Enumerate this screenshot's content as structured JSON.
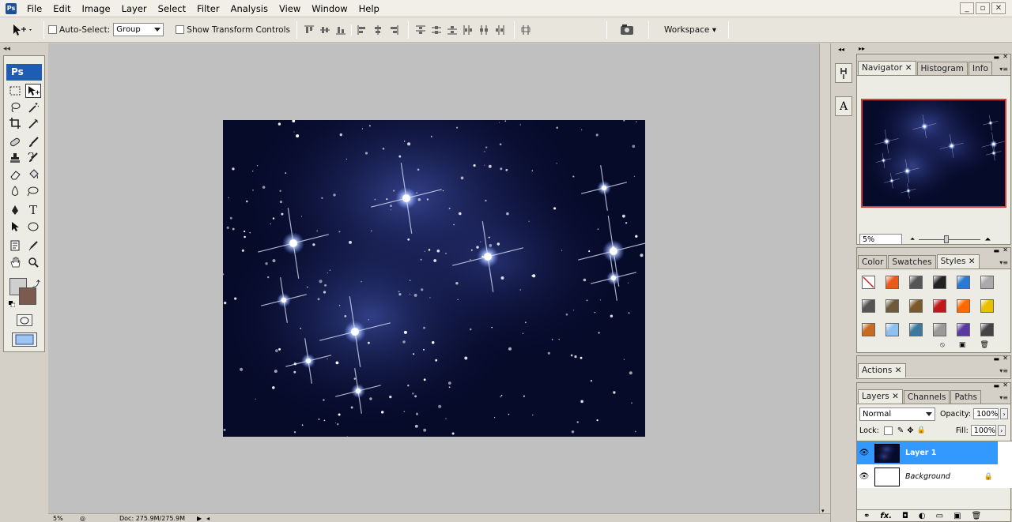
{
  "app": {
    "logo": "Ps"
  },
  "menu": [
    "File",
    "Edit",
    "Image",
    "Layer",
    "Select",
    "Filter",
    "Analysis",
    "View",
    "Window",
    "Help"
  ],
  "window_buttons": [
    "_",
    "▫",
    "✕"
  ],
  "options": {
    "auto_select_label": "Auto-Select:",
    "auto_select_value": "Group",
    "show_transform_label": "Show Transform Controls",
    "workspace_label": "Workspace ▾"
  },
  "toolbox": {
    "logo": "Ps"
  },
  "status": {
    "zoom": "5%",
    "doc": "Doc: 275.9M/275.9M"
  },
  "navigator": {
    "tabs": [
      "Navigator",
      "Histogram",
      "Info"
    ],
    "zoom": "5%"
  },
  "color_panel": {
    "tabs": [
      "Color",
      "Swatches",
      "Styles"
    ]
  },
  "actions_panel": {
    "tabs": [
      "Actions"
    ]
  },
  "layers_panel": {
    "tabs": [
      "Layers",
      "Channels",
      "Paths"
    ],
    "blend_mode": "Normal",
    "opacity_label": "Opacity:",
    "opacity_value": "100%",
    "lock_label": "Lock:",
    "fill_label": "Fill:",
    "fill_value": "100%",
    "layers": [
      {
        "name": "Layer 1",
        "selected": true
      },
      {
        "name": "Background",
        "selected": false
      }
    ]
  },
  "colors": {
    "accent": "#3399ff",
    "foreground": "#cfcfcf",
    "background": "#7b5a50",
    "canvas_bg": "#c0c0c0"
  }
}
